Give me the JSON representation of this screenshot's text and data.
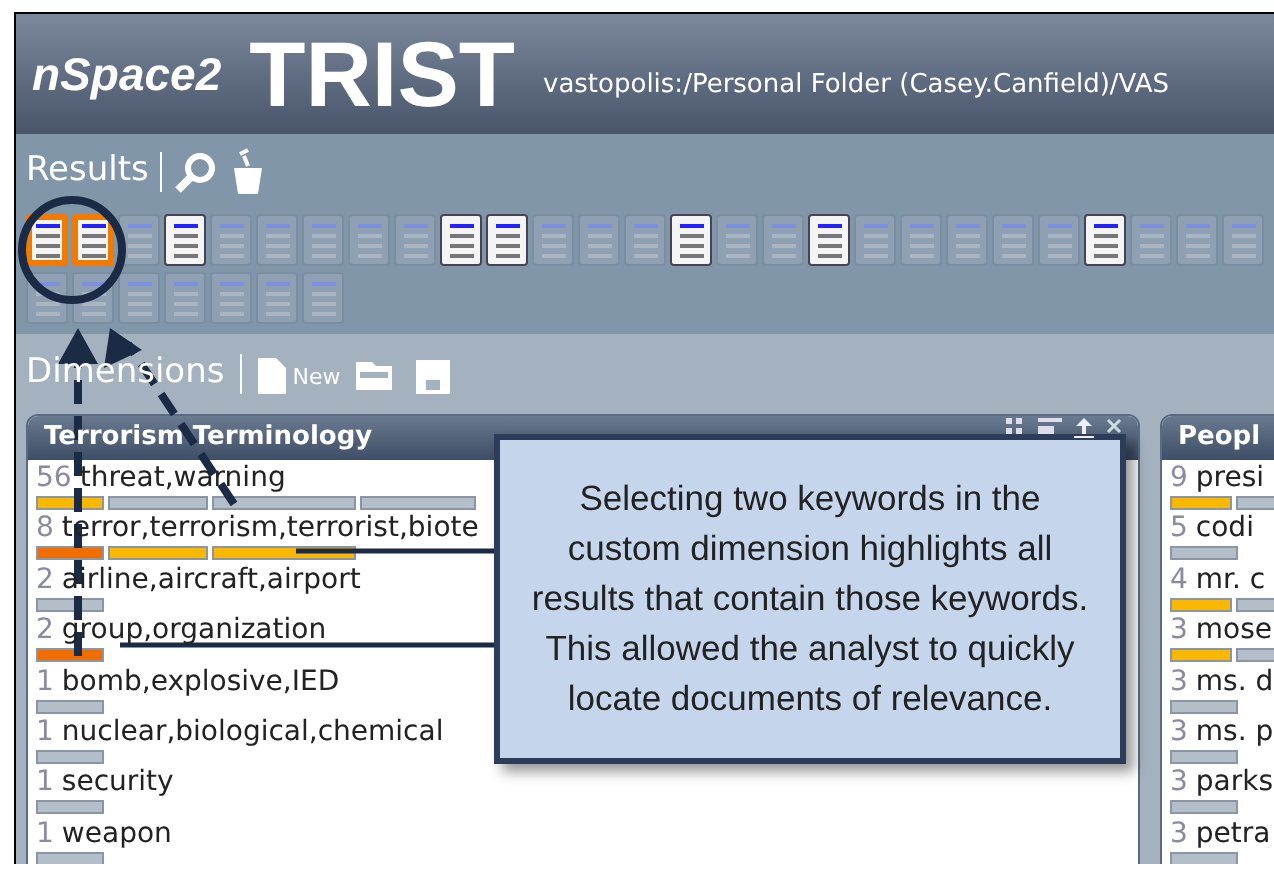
{
  "header": {
    "logo": "nSpace2",
    "title": "TRIST",
    "path": "vastopolis:/Personal Folder (Casey.Canfield)/VAS"
  },
  "results": {
    "label": "Results",
    "tiles": [
      {
        "selected": true,
        "highlighted": true
      },
      {
        "selected": true,
        "highlighted": true
      },
      {
        "selected": false,
        "highlighted": false
      },
      {
        "selected": false,
        "highlighted": true
      },
      {
        "selected": false,
        "highlighted": false
      },
      {
        "selected": false,
        "highlighted": false
      },
      {
        "selected": false,
        "highlighted": false
      },
      {
        "selected": false,
        "highlighted": false
      },
      {
        "selected": false,
        "highlighted": false
      },
      {
        "selected": false,
        "highlighted": true
      },
      {
        "selected": false,
        "highlighted": true
      },
      {
        "selected": false,
        "highlighted": false
      },
      {
        "selected": false,
        "highlighted": false
      },
      {
        "selected": false,
        "highlighted": false
      },
      {
        "selected": false,
        "highlighted": true
      },
      {
        "selected": false,
        "highlighted": false
      },
      {
        "selected": false,
        "highlighted": false
      },
      {
        "selected": false,
        "highlighted": true
      },
      {
        "selected": false,
        "highlighted": false
      },
      {
        "selected": false,
        "highlighted": false
      },
      {
        "selected": false,
        "highlighted": false
      },
      {
        "selected": false,
        "highlighted": false
      },
      {
        "selected": false,
        "highlighted": false
      },
      {
        "selected": false,
        "highlighted": true
      },
      {
        "selected": false,
        "highlighted": false
      },
      {
        "selected": false,
        "highlighted": false
      },
      {
        "selected": false,
        "highlighted": false
      },
      {
        "selected": false,
        "highlighted": false
      },
      {
        "selected": false,
        "highlighted": false
      },
      {
        "selected": false,
        "highlighted": false
      },
      {
        "selected": false,
        "highlighted": false
      },
      {
        "selected": false,
        "highlighted": false
      },
      {
        "selected": false,
        "highlighted": false
      },
      {
        "selected": false,
        "highlighted": false
      }
    ]
  },
  "dimensions": {
    "label": "Dimensions",
    "new_label": "New"
  },
  "panels": [
    {
      "title": "Terrorism Terminology",
      "items": [
        {
          "count": "56",
          "label": "threat,warning",
          "segments": [
            {
              "kind": "highlighted"
            },
            {
              "kind": "plain"
            },
            {
              "kind": "plain"
            },
            {
              "kind": "plain"
            }
          ]
        },
        {
          "count": "8",
          "label": "terror,terrorism,terrorist,biote",
          "segments": [
            {
              "kind": "selected"
            },
            {
              "kind": "highlighted"
            },
            {
              "kind": "highlighted"
            }
          ]
        },
        {
          "count": "2",
          "label": "airline,aircraft,airport",
          "segments": [
            {
              "kind": "plain"
            }
          ]
        },
        {
          "count": "2",
          "label": "group,organization",
          "segments": [
            {
              "kind": "selected"
            }
          ]
        },
        {
          "count": "1",
          "label": "bomb,explosive,IED",
          "segments": [
            {
              "kind": "plain"
            }
          ]
        },
        {
          "count": "1",
          "label": "nuclear,biological,chemical",
          "segments": [
            {
              "kind": "plain"
            }
          ]
        },
        {
          "count": "1",
          "label": "security",
          "segments": [
            {
              "kind": "plain"
            }
          ]
        },
        {
          "count": "1",
          "label": "weapon",
          "segments": [
            {
              "kind": "plain"
            }
          ]
        }
      ]
    },
    {
      "title": "Peopl",
      "items": [
        {
          "count": "9",
          "label": "presi",
          "segments": [
            {
              "kind": "highlighted"
            },
            {
              "kind": "plain"
            }
          ]
        },
        {
          "count": "5",
          "label": "codi",
          "segments": [
            {
              "kind": "plain"
            }
          ]
        },
        {
          "count": "4",
          "label": "mr. c",
          "segments": [
            {
              "kind": "highlighted"
            },
            {
              "kind": "plain"
            }
          ]
        },
        {
          "count": "3",
          "label": "mose",
          "segments": [
            {
              "kind": "highlighted"
            },
            {
              "kind": "plain"
            }
          ]
        },
        {
          "count": "3",
          "label": "ms. d",
          "segments": [
            {
              "kind": "plain"
            }
          ]
        },
        {
          "count": "3",
          "label": "ms. p",
          "segments": [
            {
              "kind": "plain"
            }
          ]
        },
        {
          "count": "3",
          "label": "parks",
          "segments": [
            {
              "kind": "plain"
            }
          ]
        },
        {
          "count": "3",
          "label": "petra",
          "segments": [
            {
              "kind": "plain"
            }
          ]
        }
      ]
    }
  ],
  "callout": {
    "text": "Selecting two keywords in the custom dimension highlights all results that contain those keywords. This allowed the analyst to quickly locate documents of relevance."
  }
}
